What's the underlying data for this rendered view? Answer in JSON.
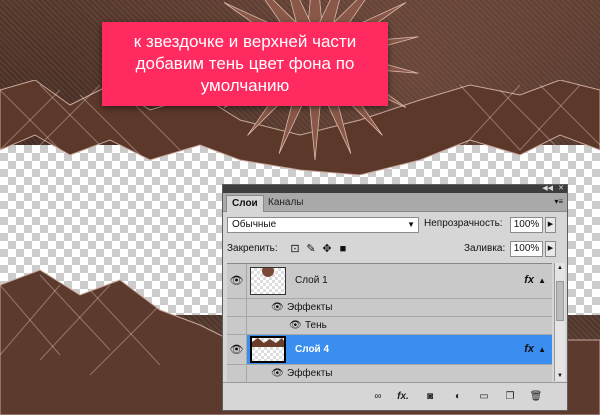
{
  "callout": {
    "line1": "к звездочке и верхней части",
    "line2": "добавим тень цвет фона по",
    "line3": "умолчанию",
    "background_color": "#ff2a5f"
  },
  "panel": {
    "titlebar": {
      "collapse_icon": "double-chevron-icon",
      "close_icon": "close-icon"
    },
    "tabs": [
      {
        "label": "Слои",
        "active": true
      },
      {
        "label": "Каналы",
        "active": false
      }
    ],
    "menu_icon": "panel-menu-icon",
    "blend_mode": "Обычные",
    "opacity_label": "Непрозрачность:",
    "opacity_value": "100%",
    "lock_label": "Закрепить:",
    "lock_icons": [
      "lock-transparent-icon",
      "lock-brush-icon",
      "lock-move-icon",
      "lock-all-icon"
    ],
    "fill_label": "Заливка:",
    "fill_value": "100%",
    "layers": [
      {
        "name": "Слой 1",
        "visible": true,
        "has_fx": true,
        "fx_label": "fx",
        "selected": false
      },
      {
        "name": "Эффекты",
        "type": "effects-header"
      },
      {
        "name": "Тень",
        "type": "effect"
      },
      {
        "name": "Слой 4",
        "visible": true,
        "has_fx": true,
        "fx_label": "fx",
        "selected": true
      },
      {
        "name": "Эффекты",
        "type": "effects-header"
      }
    ],
    "footer_icons": [
      "link-layers-icon",
      "fx-icon",
      "layer-mask-icon",
      "adjustment-layer-icon",
      "new-group-icon",
      "new-layer-icon",
      "trash-icon"
    ],
    "footer_fx_label": "fx.",
    "selection_color": "#3a8ef0"
  }
}
